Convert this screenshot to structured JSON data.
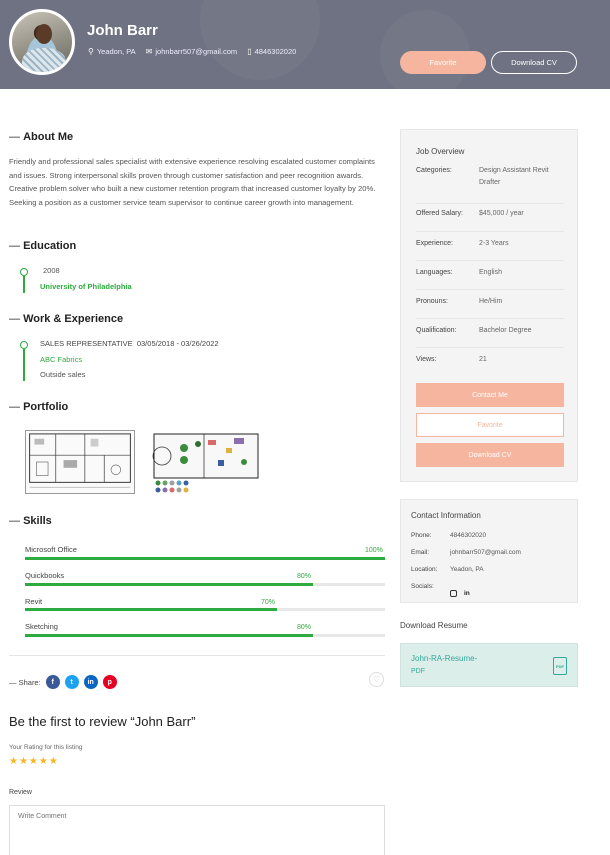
{
  "header": {
    "name": "John Barr",
    "location": "Yeadon, PA",
    "email": "johnbarr507@gmail.com",
    "phone": "4846302020",
    "favorite_label": "Favorite",
    "download_cv_label": "Download CV"
  },
  "about": {
    "title": "About Me",
    "text": "Friendly and professional sales specialist with extensive experience resolving escalated customer complaints and issues. Strong interpersonal skills proven through customer satisfaction and peer recognition awards. Creative problem solver who built a new customer retention program that increased customer loyalty by 20%. Seeking a position as a customer service team supervisor to continue career growth into management."
  },
  "education": {
    "title": "Education",
    "year": "2008",
    "school": "University of Philadelphia"
  },
  "work": {
    "title": "Work & Experience",
    "role": "SALES REPRESENTATIVE",
    "dates": "03/05/2018 - 03/26/2022",
    "company": "ABC Fabrics",
    "description": "Outside sales"
  },
  "portfolio": {
    "title": "Portfolio"
  },
  "skills": {
    "title": "Skills",
    "items": [
      {
        "name": "Microsoft Office",
        "percent_label": "100%",
        "percent": 100
      },
      {
        "name": "Quickbooks",
        "percent_label": "80%",
        "percent": 80
      },
      {
        "name": "Revit",
        "percent_label": "70%",
        "percent": 70
      },
      {
        "name": "Sketching",
        "percent_label": "80%",
        "percent": 80
      }
    ]
  },
  "share": {
    "label": "Share:",
    "networks": [
      {
        "icon": "facebook-icon",
        "glyph": "f",
        "color": "#3b5998"
      },
      {
        "icon": "twitter-icon",
        "glyph": "t",
        "color": "#1da1f2"
      },
      {
        "icon": "linkedin-icon",
        "glyph": "in",
        "color": "#0a66c2"
      },
      {
        "icon": "pinterest-icon",
        "glyph": "p",
        "color": "#e60023"
      }
    ]
  },
  "review": {
    "title": "Be the first to review “John Barr”",
    "rating_label": "Your Rating for this listing",
    "stars": "★★★★★",
    "review_label": "Review",
    "placeholder": "Write Comment"
  },
  "job_overview": {
    "title": "Job Overview",
    "rows": [
      {
        "k": "Categories:",
        "v": "Design Assistant Revit Drafter"
      },
      {
        "k": "Offered Salary:",
        "v": "$45,000 / year"
      },
      {
        "k": "Experience:",
        "v": "2-3 Years"
      },
      {
        "k": "Languages:",
        "v": "English"
      },
      {
        "k": "Pronouns:",
        "v": "He/Him"
      },
      {
        "k": "Qualification:",
        "v": "Bachelor Degree"
      },
      {
        "k": "Views:",
        "v": "21"
      }
    ],
    "contact_label": "Contact Me",
    "favorite_label": "Favorite",
    "download_label": "Download CV"
  },
  "contact_info": {
    "title": "Contact Information",
    "phone_k": "Phone:",
    "phone_v": "4846302020",
    "email_k": "Email:",
    "email_v": "johnbarr507@gmail.com",
    "location_k": "Location:",
    "location_v": "Yeadon, PA",
    "socials_k": "Socials:"
  },
  "resume": {
    "label": "Download Resume",
    "file_line1": "John-RA-Resume-",
    "file_line2": "PDF",
    "file_icon": "PDF"
  },
  "colors": {
    "accent": "#f6b59f",
    "green": "#2eaa3e",
    "header_bg": "#6e7282",
    "resume_bg": "#dceeea"
  }
}
